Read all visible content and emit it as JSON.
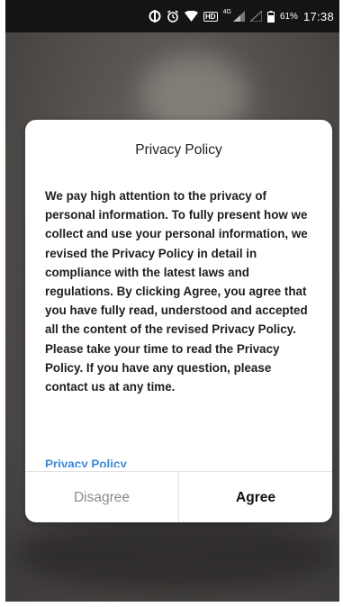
{
  "status_bar": {
    "icons": [
      "data-sync-icon",
      "alarm-icon",
      "wifi-icon",
      "hd-badge-icon",
      "signal-icon",
      "signal-empty-icon",
      "battery-icon"
    ],
    "hd_label": "HD",
    "network_label": "4G",
    "battery_percent": "61%",
    "time": "17:38"
  },
  "dialog": {
    "title": "Privacy Policy",
    "body": "We pay high attention to the privacy of personal information. To fully present how we collect and use your personal information, we revised the Privacy Policy in detail in compliance with the latest laws and regulations. By clicking Agree, you agree that you have fully read, understood and accepted all the content of the revised Privacy Policy. Please take your time to read the Privacy Policy. If you have any question, please contact us at any time.",
    "link_label": "Privacy Policy",
    "link_color": "#3a8ad8",
    "disagree_label": "Disagree",
    "agree_label": "Agree"
  }
}
